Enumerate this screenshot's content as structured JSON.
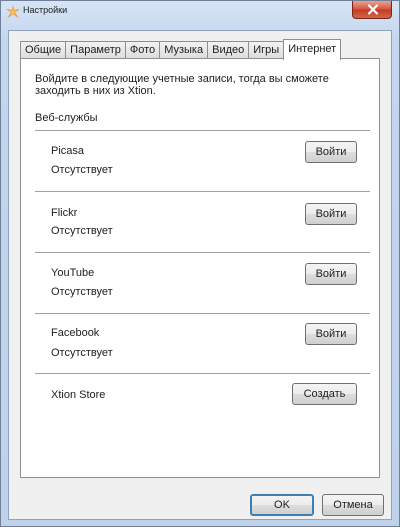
{
  "window": {
    "title": "Настройки"
  },
  "tabs": [
    {
      "label": "Общие"
    },
    {
      "label": "Параметр"
    },
    {
      "label": "Фото"
    },
    {
      "label": "Музыка"
    },
    {
      "label": "Видео"
    },
    {
      "label": "Игры"
    },
    {
      "label": "Интернет",
      "active": true
    }
  ],
  "content": {
    "intro": "Войдите в следующие учетные записи, тогда вы сможете заходить в них из Xtion.",
    "section_title": "Веб-службы",
    "services": [
      {
        "name": "Picasa",
        "status": "Отсутствует",
        "button": "Войти"
      },
      {
        "name": "Flickr",
        "status": "Отсутствует",
        "button": "Войти"
      },
      {
        "name": "YouTube",
        "status": "Отсутствует",
        "button": "Войти"
      },
      {
        "name": "Facebook",
        "status": "Отсутствует",
        "button": "Войти"
      }
    ],
    "store": {
      "name": "Xtion Store",
      "button": "Создать"
    }
  },
  "footer": {
    "ok_label": "OK",
    "cancel_label": "Отмена"
  },
  "icons": {
    "app": "xtion-star-icon",
    "close": "close-icon"
  },
  "colors": {
    "close_button": "#c9452c",
    "window_frame": "#c4d6ee",
    "panel": "#ffffff"
  }
}
